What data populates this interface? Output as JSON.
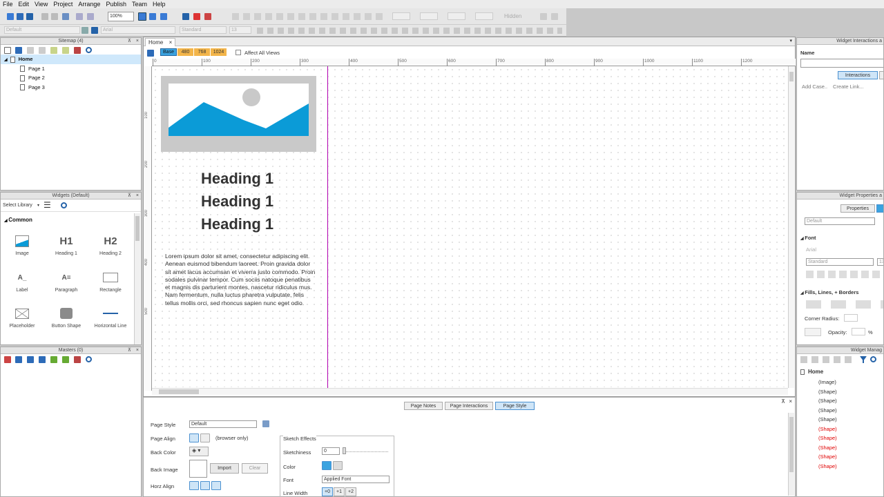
{
  "menu": [
    "File",
    "Edit",
    "View",
    "Project",
    "Arrange",
    "Publish",
    "Team",
    "Help"
  ],
  "toolbar": {
    "zoom": "100%",
    "hidden_label": "Hidden",
    "style_default": "Default",
    "font_name": "Arial",
    "font_style": "Standard",
    "font_size": "13"
  },
  "sitemap": {
    "title": "Sitemap (4)",
    "root": "Home",
    "pages": [
      "Page 1",
      "Page 2",
      "Page 3"
    ]
  },
  "widgets": {
    "title": "Widgets (Default)",
    "select_library": "Select Library",
    "section": "Common",
    "items": [
      {
        "glyph": "",
        "label": "Image",
        "icon": "image-icon"
      },
      {
        "glyph": "H1",
        "label": "Heading 1",
        "icon": "heading1-icon"
      },
      {
        "glyph": "H2",
        "label": "Heading 2",
        "icon": "heading2-icon"
      },
      {
        "glyph": "A_",
        "label": "Label",
        "icon": "label-icon"
      },
      {
        "glyph": "A≡",
        "label": "Paragraph",
        "icon": "paragraph-icon"
      },
      {
        "glyph": "",
        "label": "Rectangle",
        "icon": "rectangle-icon"
      },
      {
        "glyph": "",
        "label": "Placeholder",
        "icon": "placeholder-icon"
      },
      {
        "glyph": "",
        "label": "Button Shape",
        "icon": "button-shape-icon"
      },
      {
        "glyph": "",
        "label": "Horizontal Line",
        "icon": "horizontal-line-icon"
      }
    ]
  },
  "masters": {
    "title": "Masters (0)"
  },
  "canvas": {
    "tab": "Home",
    "views": [
      "Base",
      "480",
      "768",
      "1024"
    ],
    "affect_all": "Affect All Views",
    "ruler_top": [
      "0",
      "100",
      "200",
      "300",
      "400",
      "500",
      "600",
      "700",
      "800",
      "900",
      "1000",
      "1100",
      "1200"
    ],
    "ruler_left": [
      "100",
      "200",
      "300",
      "400",
      "500"
    ],
    "headings": [
      "Heading 1",
      "Heading 1",
      "Heading 1"
    ],
    "lorem": "Lorem ipsum dolor sit amet, consectetur adipiscing elit. Aenean euismod bibendum laoreet. Proin gravida dolor sit amet lacus accumsan et viverra justo commodo. Proin sodales pulvinar tempor. Cum sociis natoque penatibus et magnis dis parturient montes, nascetur ridiculus mus. Nam fermentum, nulla luctus pharetra vulputate, felis tellus mollis orci, sed rhoncus sapien nunc eget odio."
  },
  "bottom": {
    "tabs": [
      "Page Notes",
      "Page Interactions",
      "Page Style"
    ],
    "page_style_label": "Page Style",
    "page_style_value": "Default",
    "page_align_label": "Page Align",
    "browser_only": "(browser only)",
    "back_color": "Back Color",
    "back_image": "Back Image",
    "import": "Import",
    "clear": "Clear",
    "horz_align": "Horz Align",
    "sketch": "Sketch Effects",
    "sketchiness": "Sketchiness",
    "sketch_value": "0",
    "color": "Color",
    "font": "Font",
    "font_value": "Applied Font",
    "line_width": "Line Width",
    "lw": [
      "+0",
      "+1",
      "+2"
    ]
  },
  "interactions": {
    "title": "Widget Interactions a",
    "name": "Name",
    "tab": "Interactions",
    "add_case": "Add Case..",
    "create_link": "Create Link..."
  },
  "properties": {
    "title": "Widget Properties a",
    "tab": "Properties",
    "style": "Default",
    "font_section": "Font",
    "font": "Arial",
    "font_style": "Standard",
    "font_size": "13",
    "fills": "Fills, Lines, + Borders",
    "corner": "Corner Radius:",
    "opacity": "Opacity:",
    "pct": "%"
  },
  "manager": {
    "title": "Widget Manag",
    "root": "Home",
    "items": [
      "(Image)",
      "(Shape)",
      "(Shape)",
      "(Shape)",
      "(Shape)",
      "(Shape)",
      "(Shape)",
      "(Shape)",
      "(Shape)",
      "(Shape)"
    ]
  },
  "colors": {
    "accent": "#0b9bd7",
    "magenta": "#b000b0",
    "view_tab": "#f3b54a",
    "red": "#e00000"
  }
}
